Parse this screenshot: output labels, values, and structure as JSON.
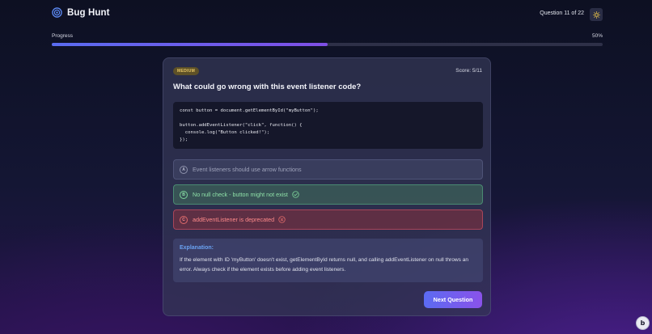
{
  "app": {
    "title": "Bug Hunt"
  },
  "header": {
    "question_counter": "Question 11 of 22",
    "theme_icon": "sun-icon"
  },
  "progress": {
    "label": "Progress",
    "percent_text": "50%",
    "value": 0.5,
    "fill_color": "#6a5ef0"
  },
  "card": {
    "difficulty": "MEDIUM",
    "score": "Score: 5/11",
    "question": "What could go wrong with this event listener code?",
    "code": "const button = document.getElementById(\"myButton\");\n\nbutton.addEventListener(\"click\", function() {\n  console.log(\"Button clicked!\");\n});"
  },
  "options": [
    {
      "letter": "A",
      "text": "Event listeners should use arrow functions",
      "state": "neutral"
    },
    {
      "letter": "B",
      "text": "No null check - button might not exist",
      "state": "correct",
      "icon": "check-circle-icon",
      "color": "#7dd49a"
    },
    {
      "letter": "C",
      "text": "addEventListener is deprecated",
      "state": "incorrect",
      "icon": "x-circle-icon",
      "color": "#e06a6a"
    }
  ],
  "explanation": {
    "title": "Explanation:",
    "text": "If the element with ID 'myButton' doesn't exist, getElementById returns null, and calling addEventListener on null throws an error. Always check if the element exists before adding event listeners."
  },
  "next_button": {
    "label": "Next Question"
  },
  "corner_badge": {
    "letter": "b"
  }
}
